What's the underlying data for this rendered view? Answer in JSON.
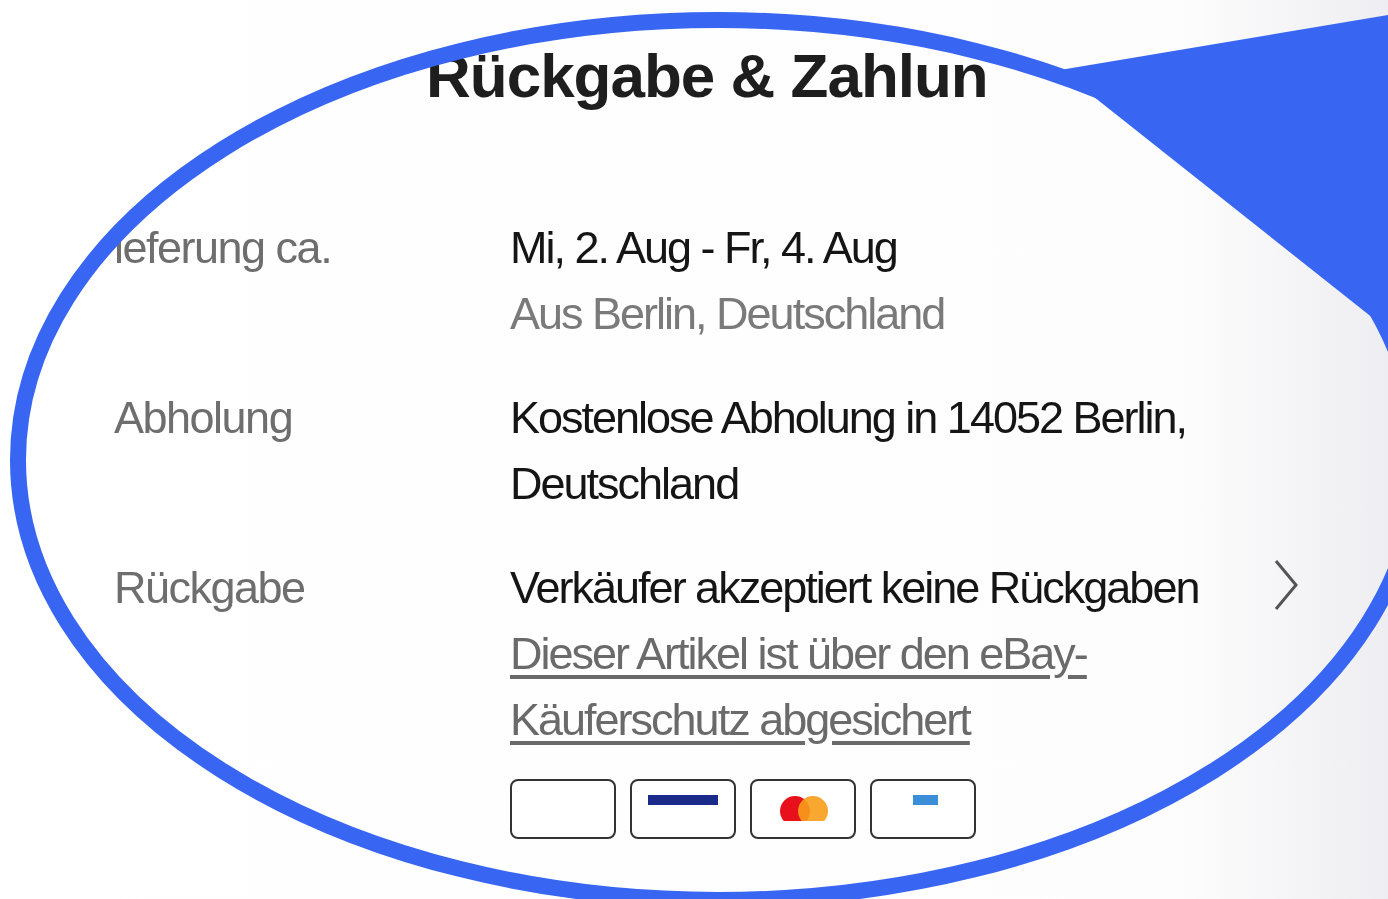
{
  "title": "Rückgabe & Zahlun",
  "rows": [
    {
      "label": "ieferung ca.",
      "lines": [
        {
          "kind": "value",
          "text": "Mi, 2. Aug - Fr, 4. Aug"
        },
        {
          "kind": "note",
          "text": "Aus Berlin, Deutschland"
        }
      ],
      "has_chevron": false
    },
    {
      "label": "Abholung",
      "lines": [
        {
          "kind": "value",
          "text": "Kostenlose Abholung in 14052 Berlin, Deutschland"
        }
      ],
      "has_chevron": false
    },
    {
      "label": "Rückgabe",
      "lines": [
        {
          "kind": "value",
          "text": "Verkäufer akzeptiert keine Rückgaben"
        },
        {
          "kind": "link",
          "text": "Dieser Artikel ist über den eBay-Käuferschutz abgesichert"
        }
      ],
      "has_chevron": true
    }
  ],
  "payment_cards": [
    {
      "kind": "plain"
    },
    {
      "kind": "visa"
    },
    {
      "kind": "mastercard"
    },
    {
      "kind": "paypal"
    }
  ]
}
